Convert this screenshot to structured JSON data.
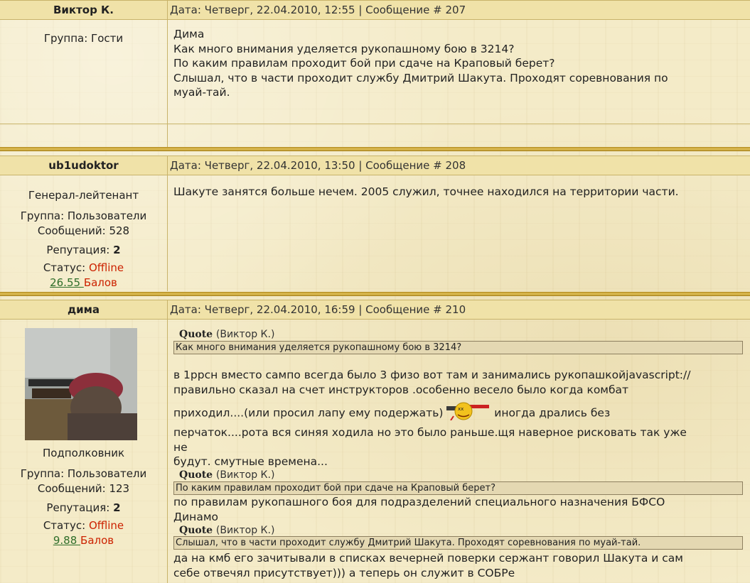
{
  "posts": [
    {
      "author": "Виктор К.",
      "meta": "Дата: Четверг, 22.04.2010, 12:55 | Сообщение # 207",
      "group": "Группа: Гости",
      "lines": [
        "Дима",
        "Как много внимания уделяется рукопашному бою в 3214?",
        "По каким правилам проходит бой при сдаче на Краповый берет?",
        "Слышал, что в части проходит службу Дмитрий Шакута. Проходят соревнования по",
        "муай-тай."
      ]
    },
    {
      "author": "ub1udoktor",
      "meta": "Дата: Четверг, 22.04.2010, 13:50 | Сообщение # 208",
      "rank": "Генерал-лейтенант",
      "group": "Группа: Пользователи",
      "messages": "Сообщений: 528",
      "rep_label": "Репутация:",
      "rep_value": "2",
      "status_label": "Статус:",
      "status_value": "Offline",
      "balls_value": "26.55 ",
      "balls_word": "Балов",
      "lines": [
        "Шакуте занятся больше нечем. 2005 служил, точнее находился на территории части."
      ]
    },
    {
      "author": "дима",
      "meta": "Дата: Четверг, 22.04.2010, 16:59 | Сообщение # 210",
      "rank": "Подполковник",
      "group": "Группа: Пользователи",
      "messages": "Сообщений: 123",
      "rep_label": "Репутация:",
      "rep_value": "2",
      "status_label": "Статус:",
      "status_value": "Offline",
      "balls_value": "9.88 ",
      "balls_word": "Балов",
      "quote_label": "Quote",
      "quotes": [
        {
          "author": "(Виктор К.)",
          "text": "Как много внимания уделяется рукопашному бою в 3214?"
        },
        {
          "author": "(Виктор К.)",
          "text": "По каким правилам проходит бой при сдаче на Краповый берет?"
        },
        {
          "author": "(Виктор К.)",
          "text": "Слышал, что в части проходит службу Дмитрий Шакута. Проходят соревнования по муай-тай."
        }
      ],
      "reply1": [
        "в 1ррсн вместо сампо всегда было 3 физо вот там и занимались рукопашкойjavascript://",
        "правильно сказал на счет инструкторов .особенно весело было когда комбат",
        "приходил....(или просил лапу ему подержать)",
        "иногда дрались без",
        "перчаток....рота вся синяя ходила но это было раньше.щя наверное рисковать так уже",
        "не",
        "будут. смутные времена..."
      ],
      "reply2": [
        "по правилам рукопашного боя для подразделений специального назначения БФСО",
        "Динамо"
      ],
      "reply3": [
        "да на кмб его зачитывали в списках вечерней поверки сержант говорил Шакута и сам",
        "себе отвечял присутствует))) а теперь он служит в СОБРе"
      ]
    }
  ]
}
